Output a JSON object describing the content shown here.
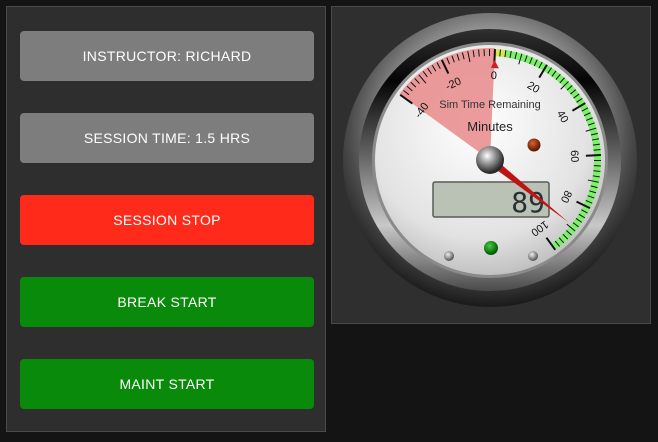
{
  "buttons": {
    "instructor": "INSTRUCTOR: RICHARD",
    "session_time": "SESSION TIME: 1.5 HRS",
    "session_stop": "SESSION STOP",
    "break_start": "BREAK START",
    "maint_start": "MAINT START"
  },
  "gauge": {
    "title": "Sim Time Remaining",
    "unit": "Minutes",
    "value": "89",
    "value_number": 89,
    "scale_min": -40,
    "scale_max": 100,
    "tick_labels": [
      "-40",
      "-20",
      "0",
      "20",
      "40",
      "60",
      "80",
      "100"
    ],
    "colors": {
      "red_zone": "#e88a8a",
      "green_band": "#7cf06a",
      "yellow_band": "#d6e84a",
      "needle": "#c01414",
      "indicator_top": "#8a2a08",
      "indicator_bottom": "#0a8a0a"
    }
  },
  "colors": {
    "red_button": "#ff2a1a",
    "green_button": "#0a8a0a",
    "gray_button": "#7d7d7d"
  }
}
